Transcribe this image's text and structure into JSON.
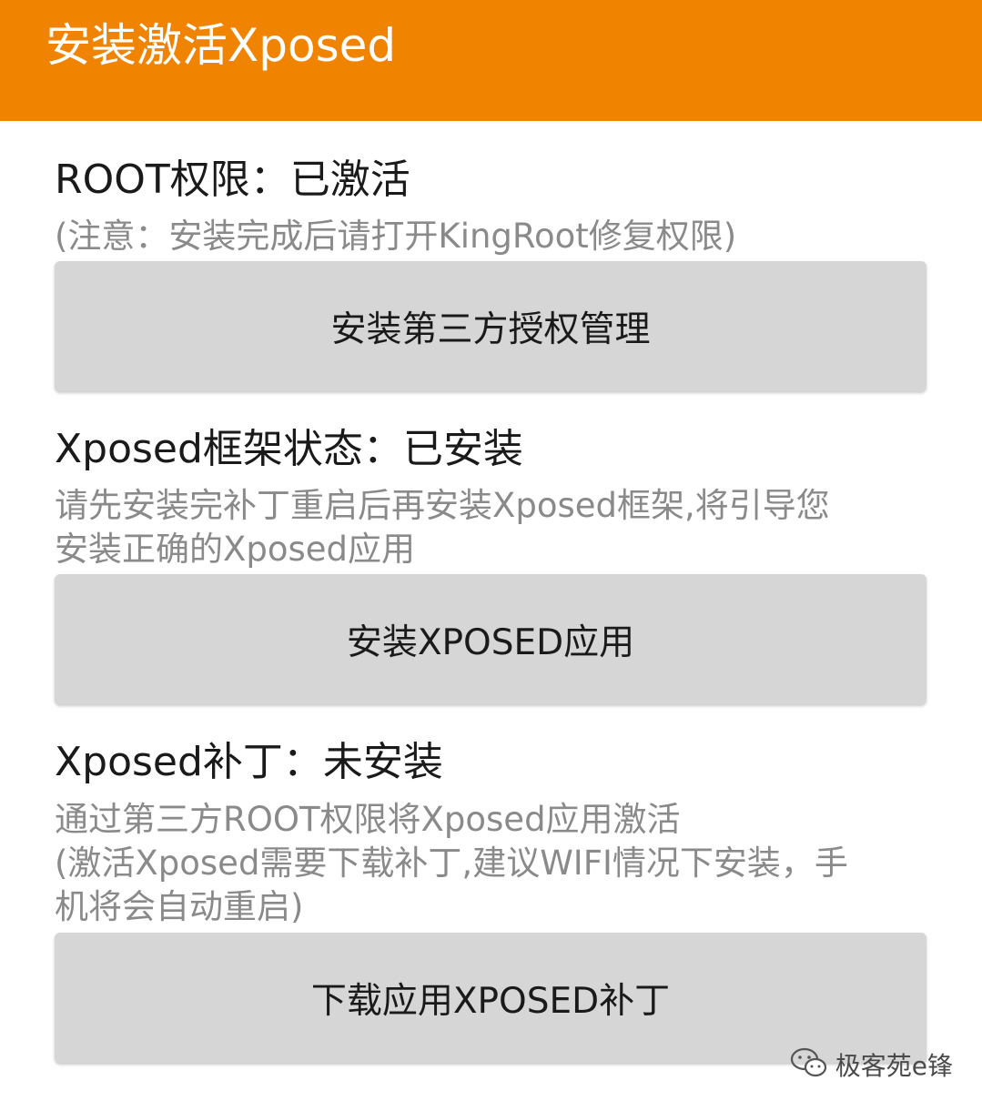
{
  "app_bar": {
    "title": "安装激活Xposed",
    "color": "#f08300"
  },
  "sections": [
    {
      "status": "ROOT权限：已激活",
      "notes": [
        "(注意：安装完成后请打开KingRoot修复权限)"
      ],
      "button_label": "安装第三方授权管理"
    },
    {
      "status": "Xposed框架状态：已安装",
      "notes": [
        "请先安装完补丁重启后再安装Xposed框架,将引导您",
        "安装正确的Xposed应用"
      ],
      "button_label": "安装XPOSED应用"
    },
    {
      "status": "Xposed补丁：未安装",
      "notes": [
        "通过第三方ROOT权限将Xposed应用激活",
        "(激活Xposed需要下载补丁,建议WIFI情况下安装，手",
        "机将会自动重启)"
      ],
      "button_label": "下载应用XPOSED补丁"
    }
  ],
  "watermark": {
    "icon": "wechat-icon",
    "text": "极客苑e锋"
  }
}
